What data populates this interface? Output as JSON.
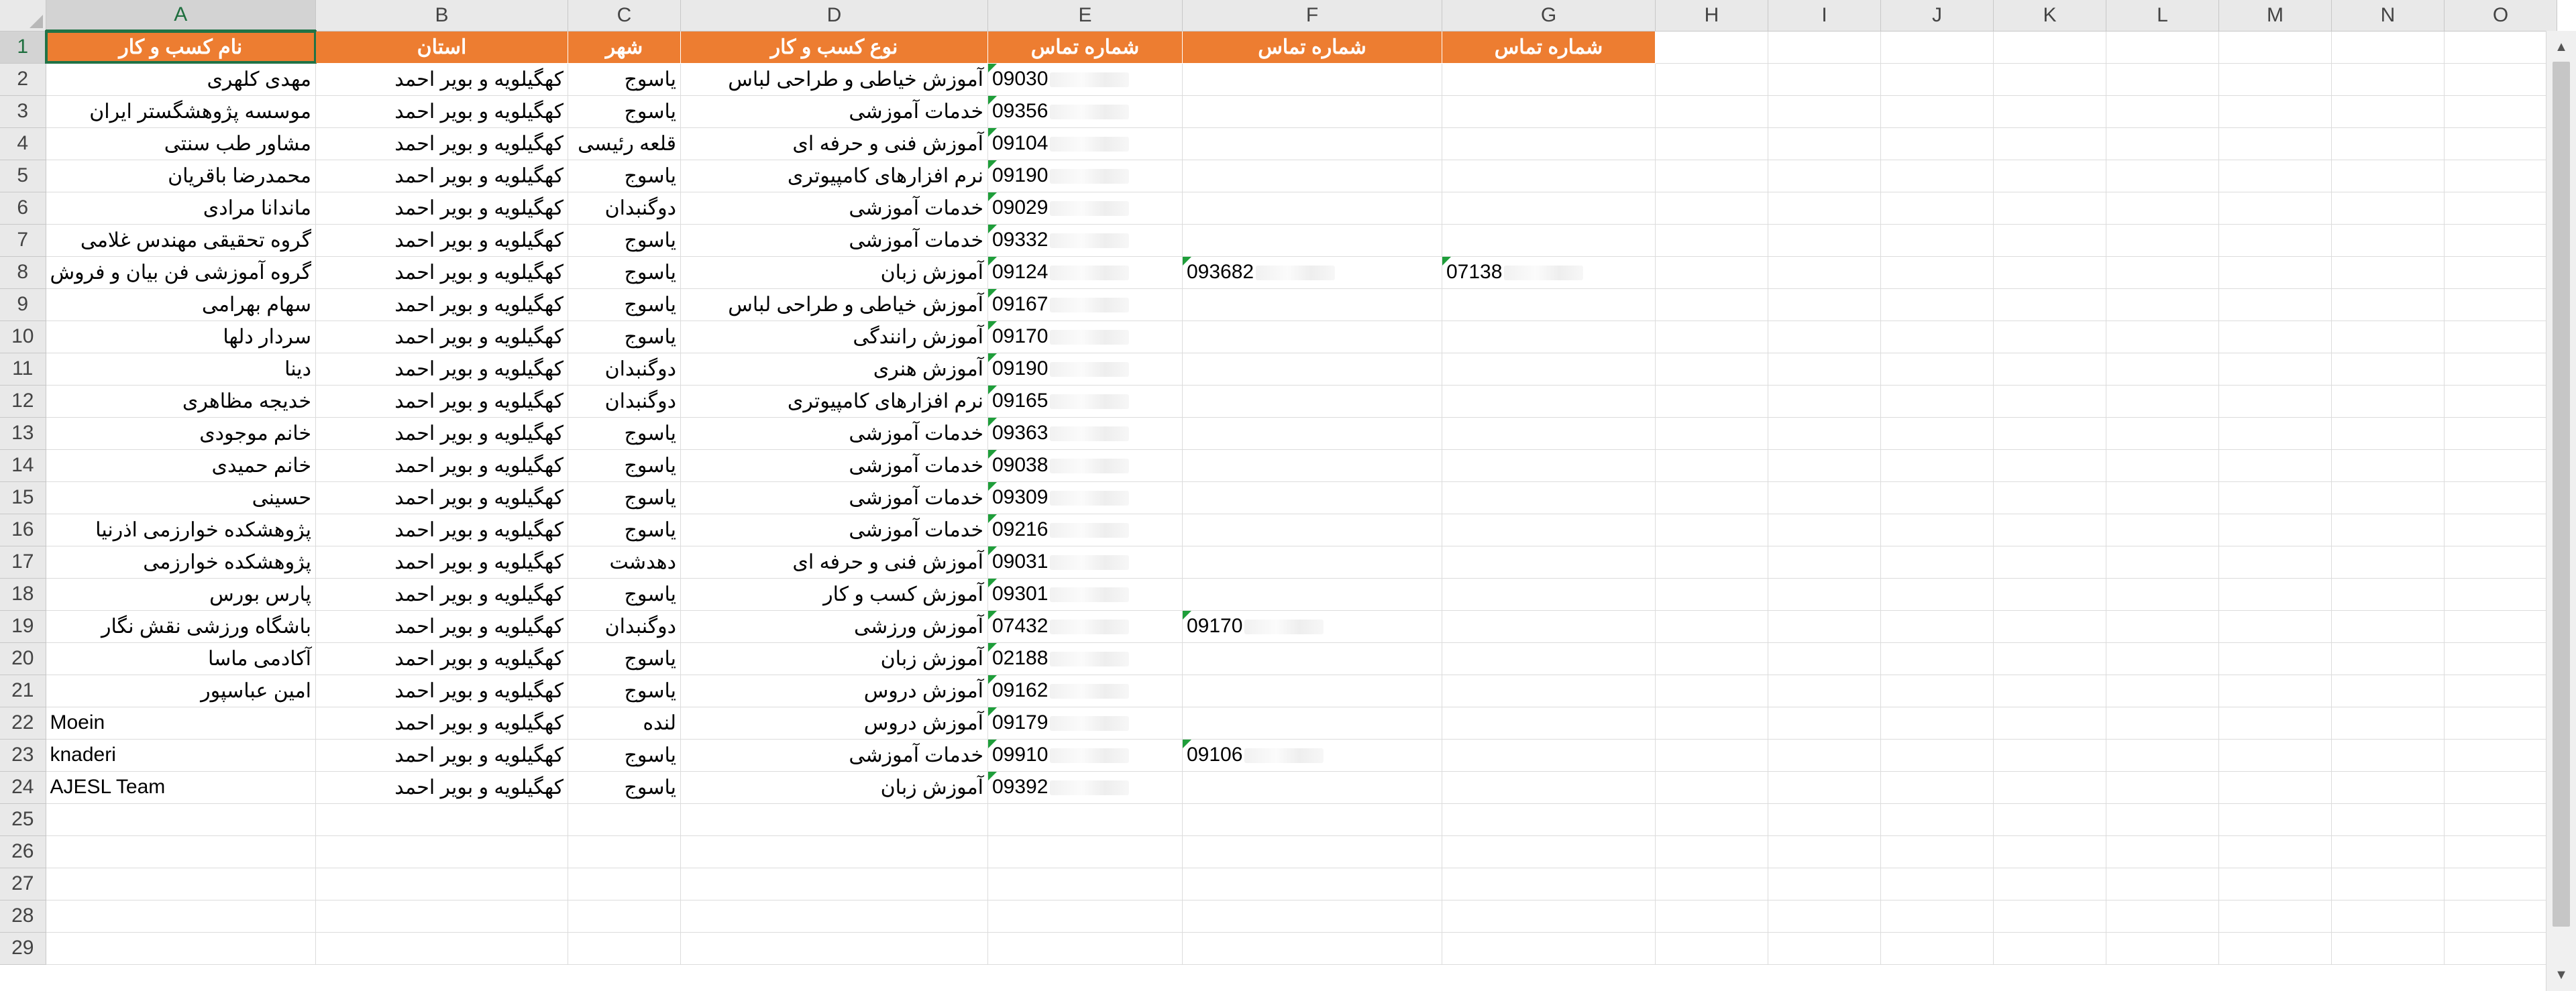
{
  "columns": [
    "A",
    "B",
    "C",
    "D",
    "E",
    "F",
    "G",
    "H",
    "I",
    "J",
    "K",
    "L",
    "M",
    "N",
    "O"
  ],
  "row_numbers": [
    "1",
    "2",
    "3",
    "4",
    "5",
    "6",
    "7",
    "8",
    "9",
    "10",
    "11",
    "12",
    "13",
    "14",
    "15",
    "16",
    "17",
    "18",
    "19",
    "20",
    "21",
    "22",
    "23",
    "24",
    "25",
    "26",
    "27",
    "28",
    "29"
  ],
  "header_row": [
    "نام کسب و کار",
    "استان",
    "شهر",
    "نوع کسب و کار",
    "شماره تماس",
    "شماره تماس",
    "شماره تماس"
  ],
  "rows": [
    {
      "name": "مهدی کلهری",
      "province": "کهگیلویه و بویر احمد",
      "city": "یاسوج",
      "type": "آموزش خیاطی و طراحی لباس",
      "phone1": "09030",
      "phone2": "",
      "phone3": ""
    },
    {
      "name": "موسسه پژوهشگستر ایران",
      "province": "کهگیلویه و بویر احمد",
      "city": "یاسوج",
      "type": "خدمات آموزشی",
      "phone1": "09356",
      "phone2": "",
      "phone3": ""
    },
    {
      "name": "مشاور طب سنتی",
      "province": "کهگیلویه و بویر احمد",
      "city": "قلعه رئیسی",
      "type": "آموزش فنی و حرفه ای",
      "phone1": "09104",
      "phone2": "",
      "phone3": ""
    },
    {
      "name": "محمدرضا باقریان",
      "province": "کهگیلویه و بویر احمد",
      "city": "یاسوج",
      "type": "نرم افزارهای کامپیوتری",
      "phone1": "09190",
      "phone2": "",
      "phone3": ""
    },
    {
      "name": "ماندانا مرادی",
      "province": "کهگیلویه و بویر احمد",
      "city": "دوگنبدان",
      "type": "خدمات آموزشی",
      "phone1": "09029",
      "phone2": "",
      "phone3": ""
    },
    {
      "name": "گروه تحقیقی مهندس غلامی",
      "province": "کهگیلویه و بویر احمد",
      "city": "یاسوج",
      "type": "خدمات آموزشی",
      "phone1": "09332",
      "phone2": "",
      "phone3": ""
    },
    {
      "name": "گروه آموزشی فن بیان و فروش",
      "province": "کهگیلویه و بویر احمد",
      "city": "یاسوج",
      "type": "آموزش زبان",
      "phone1": "09124",
      "phone2": "093682",
      "phone3": "07138"
    },
    {
      "name": "سهام بهرامی",
      "province": "کهگیلویه و بویر احمد",
      "city": "یاسوج",
      "type": "آموزش خیاطی و طراحی لباس",
      "phone1": "09167",
      "phone2": "",
      "phone3": ""
    },
    {
      "name": "سردار دلها",
      "province": "کهگیلویه و بویر احمد",
      "city": "یاسوج",
      "type": "آموزش رانندگی",
      "phone1": "09170",
      "phone2": "",
      "phone3": ""
    },
    {
      "name": "دینا",
      "province": "کهگیلویه و بویر احمد",
      "city": "دوگنبدان",
      "type": "آموزش هنری",
      "phone1": "09190",
      "phone2": "",
      "phone3": ""
    },
    {
      "name": "خدیجه مظاهری",
      "province": "کهگیلویه و بویر احمد",
      "city": "دوگنبدان",
      "type": "نرم افزارهای کامپیوتری",
      "phone1": "09165",
      "phone2": "",
      "phone3": ""
    },
    {
      "name": "خانم موجودی",
      "province": "کهگیلویه و بویر احمد",
      "city": "یاسوج",
      "type": "خدمات آموزشی",
      "phone1": "09363",
      "phone2": "",
      "phone3": ""
    },
    {
      "name": "خانم حمیدی",
      "province": "کهگیلویه و بویر احمد",
      "city": "یاسوج",
      "type": "خدمات آموزشی",
      "phone1": "09038",
      "phone2": "",
      "phone3": ""
    },
    {
      "name": "حسینی",
      "province": "کهگیلویه و بویر احمد",
      "city": "یاسوج",
      "type": "خدمات آموزشی",
      "phone1": "09309",
      "phone2": "",
      "phone3": ""
    },
    {
      "name": "پژوهشکده خوارزمی اذرنیا",
      "province": "کهگیلویه و بویر احمد",
      "city": "یاسوج",
      "type": "خدمات آموزشی",
      "phone1": "09216",
      "phone2": "",
      "phone3": ""
    },
    {
      "name": "پژوهشکده خوارزمی",
      "province": "کهگیلویه و بویر احمد",
      "city": "دهدشت",
      "type": "آموزش فنی و حرفه ای",
      "phone1": "09031",
      "phone2": "",
      "phone3": ""
    },
    {
      "name": "پارس بورس",
      "province": "کهگیلویه و بویر احمد",
      "city": "یاسوج",
      "type": "آموزش کسب و کار",
      "phone1": "09301",
      "phone2": "",
      "phone3": ""
    },
    {
      "name": "باشگاه ورزشی نقش نگار",
      "province": "کهگیلویه و بویر احمد",
      "city": "دوگنبدان",
      "type": "آموزش ورزشی",
      "phone1": "07432",
      "phone2": "09170",
      "phone3": ""
    },
    {
      "name": "آکادمی ماسا",
      "province": "کهگیلویه و بویر احمد",
      "city": "یاسوج",
      "type": "آموزش زبان",
      "phone1": "02188",
      "phone2": "",
      "phone3": ""
    },
    {
      "name": "امین عباسپور",
      "province": "کهگیلویه و بویر احمد",
      "city": "یاسوج",
      "type": "آموزش دروس",
      "phone1": "09162",
      "phone2": "",
      "phone3": ""
    },
    {
      "name": "Moein",
      "province": "کهگیلویه و بویر احمد",
      "city": "لنده",
      "type": "آموزش دروس",
      "phone1": "09179",
      "phone2": "",
      "phone3": ""
    },
    {
      "name": "knaderi",
      "province": "کهگیلویه و بویر احمد",
      "city": "یاسوج",
      "type": "خدمات آموزشی",
      "phone1": "09910",
      "phone2": "09106",
      "phone3": ""
    },
    {
      "name": "AJESL Team",
      "province": "کهگیلویه و بویر احمد",
      "city": "یاسوج",
      "type": "آموزش زبان",
      "phone1": "09392",
      "phone2": "",
      "phone3": ""
    }
  ],
  "colors": {
    "header_fill": "#ed7d31",
    "header_text": "#ffffff",
    "selection": "#217346",
    "gridline": "#dcdcdc",
    "chrome": "#e9e9e9",
    "error_marker": "#1e9e3a"
  },
  "icons": {
    "select_all": "select-all-triangle-icon",
    "scroll_up": "scroll-up-arrow-icon",
    "scroll_down": "scroll-down-arrow-icon"
  }
}
